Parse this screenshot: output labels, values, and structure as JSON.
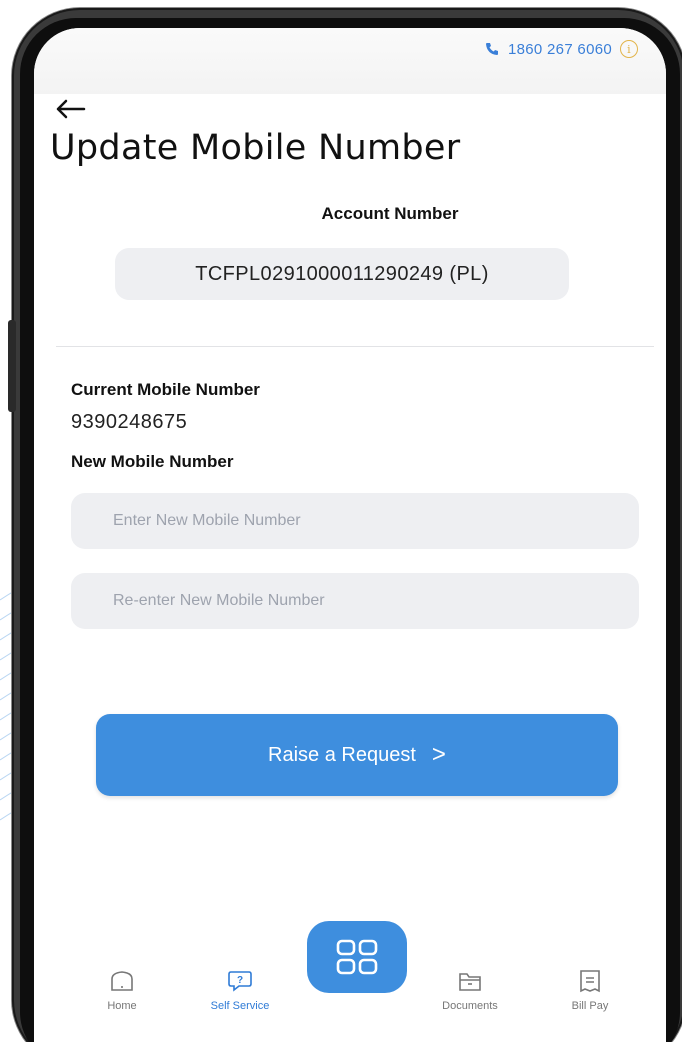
{
  "status": {
    "phone": "1860 267 6060"
  },
  "header": {
    "title": "Update Mobile Number"
  },
  "account": {
    "label": "Account Number",
    "value": "TCFPL0291000011290249 (PL)"
  },
  "current_mobile": {
    "label": "Current Mobile Number",
    "value": "9390248675"
  },
  "new_mobile": {
    "label": "New Mobile Number",
    "new_placeholder": "Enter New Mobile Number",
    "reenter_placeholder": "Re-enter New Mobile Number"
  },
  "action": {
    "label": "Raise a Request",
    "chevron": ">"
  },
  "nav": {
    "items": [
      {
        "label": "Home",
        "icon": "home-icon"
      },
      {
        "label": "Self Service",
        "icon": "help-chat-icon",
        "active": true
      },
      {
        "label": "Documents",
        "icon": "folder-icon"
      },
      {
        "label": "Bill Pay",
        "icon": "bill-icon"
      }
    ],
    "center_icon": "grid-icon"
  },
  "colors": {
    "accent": "#3e8ede",
    "phone_text": "#3a7fd8",
    "info": "#e2b44a"
  }
}
